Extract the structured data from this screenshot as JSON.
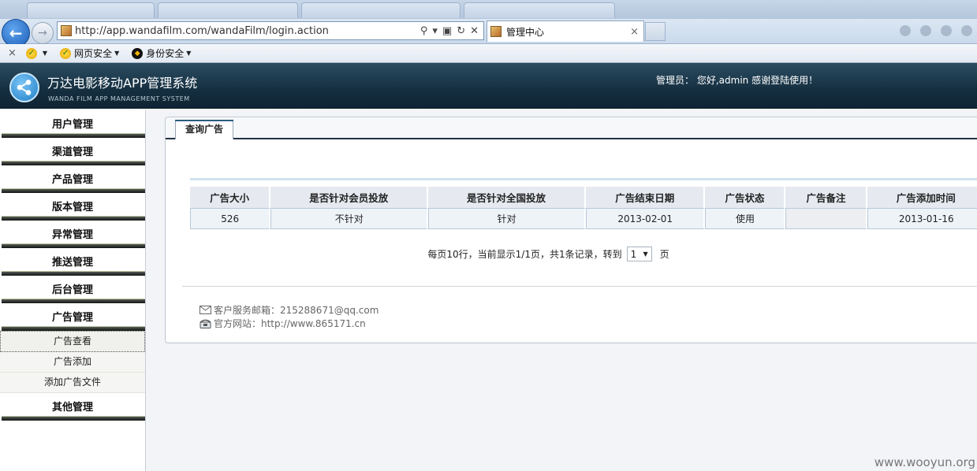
{
  "browser": {
    "url": "http://app.wandafilm.com/wandaFilm/login.action",
    "tab_title": "管理中心",
    "tab_close": "×",
    "toolbar": {
      "close": "×",
      "web_security": "网页安全",
      "identity_security": "身份安全"
    }
  },
  "header": {
    "title": "万达电影移动APP管理系统",
    "subtitle": "WANDA FILM APP MANAGEMENT SYSTEM",
    "admin_label": "管理员：",
    "greeting": "您好,admin 感谢登陆使用！"
  },
  "sidebar": {
    "menus": [
      {
        "label": "用户管理"
      },
      {
        "label": "渠道管理"
      },
      {
        "label": "产品管理"
      },
      {
        "label": "版本管理"
      },
      {
        "label": "异常管理"
      },
      {
        "label": "推送管理"
      },
      {
        "label": "后台管理"
      },
      {
        "label": "广告管理"
      }
    ],
    "ad_sub_items": [
      {
        "label": "广告查看"
      },
      {
        "label": "广告添加"
      },
      {
        "label": "添加广告文件"
      }
    ],
    "other": {
      "label": "其他管理"
    }
  },
  "content": {
    "tab": "查询广告",
    "table": {
      "headers": [
        "广告大小",
        "是否针对会员投放",
        "是否针对全国投放",
        "广告结束日期",
        "广告状态",
        "广告备注",
        "广告添加时间"
      ],
      "rows": [
        [
          "526",
          "不针对",
          "针对",
          "2013-02-01",
          "使用",
          "",
          "2013-01-16"
        ]
      ]
    },
    "pager": {
      "text": "每页10行，当前显示1/1页，共1条记录，转到",
      "current_page": "1",
      "suffix": "页"
    },
    "footer": {
      "email": "客户服务邮箱：215288671@qq.com",
      "site": "官方网站：http://www.865171.cn"
    }
  },
  "watermark": "www.wooyun.org",
  "colors": {
    "header_bg": "#152f40",
    "accent_blue": "#1f7fc8",
    "menu_bar": "#101210"
  }
}
